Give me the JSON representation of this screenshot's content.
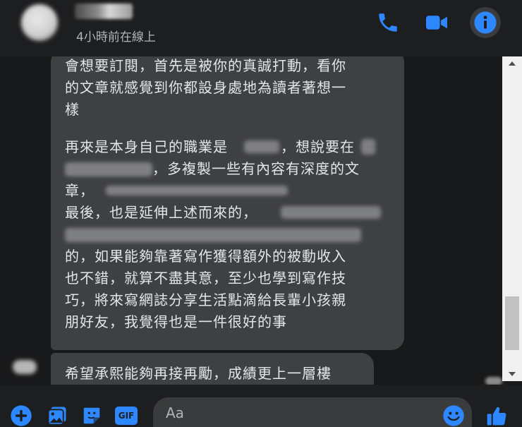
{
  "header": {
    "status": "4小時前在線上",
    "icons": {
      "call": "phone-icon",
      "video": "video-camera-icon",
      "info": "info-icon"
    }
  },
  "messages": {
    "main": {
      "p1": "會想要訂閱，首先是被你的真誠打動，看你\n的文章就感覺到你都設身處地為讀者著想一\n樣",
      "p2_line1": "再來是本身自己的職業是",
      "p2_line1b": "，想說要在",
      "p2_line2": "，多複製一些有內容有深度的文",
      "p2_line3": "章，",
      "p3_line1": "最後，也是延伸上述而來的，",
      "p3_rest": "的，如果能夠靠著寫作獲得額外的被動收入\n也不錯，就算不盡其意，至少也學到寫作技\n巧，將來寫網誌分享生活點滴給長輩小孩親\n朋好友，我覺得也是一件很好的事"
    },
    "second": "希望承熙能夠再接再勵，成績更上一層樓"
  },
  "composer": {
    "placeholder": "Aa",
    "icons": [
      "plus-icon",
      "image-icon",
      "sticker-icon",
      "gif-icon",
      "emoji-icon",
      "like-icon"
    ],
    "gif_label": "GIF"
  },
  "colors": {
    "accent": "#2d88ff",
    "bubble": "#3e4042",
    "background": "#18191a",
    "text": "#e4e6eb"
  }
}
